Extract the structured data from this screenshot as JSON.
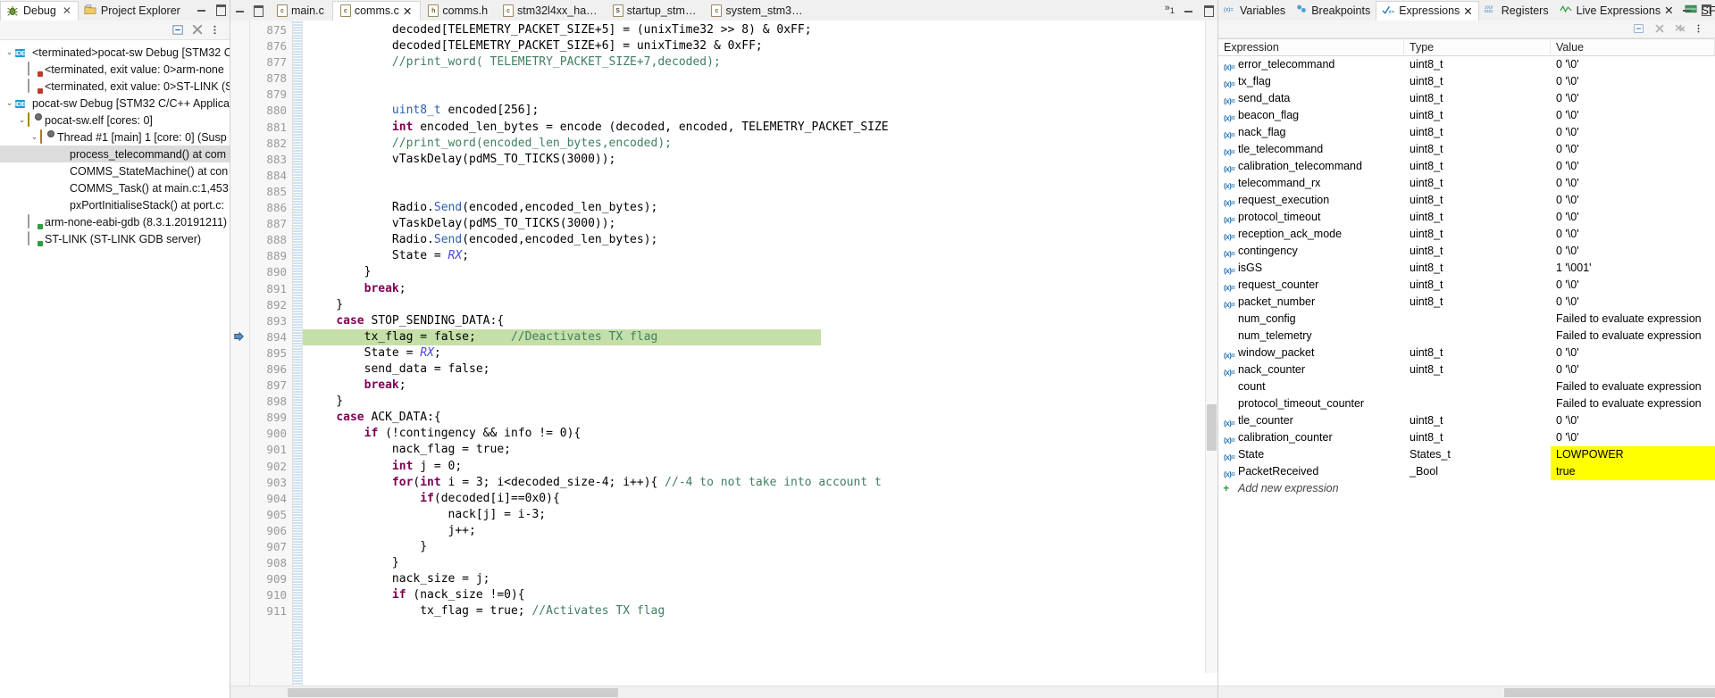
{
  "left_panel": {
    "tabs": [
      {
        "label": "Debug",
        "icon": "bug-icon",
        "active": true,
        "closable": true
      },
      {
        "label": "Project Explorer",
        "icon": "project-folder-icon",
        "active": false,
        "closable": false
      }
    ],
    "toolbar": [
      {
        "name": "collapse-all-icon",
        "label": "⊖"
      },
      {
        "name": "remove-all-terminated-icon",
        "label": "✖"
      },
      {
        "name": "view-menu-icon",
        "label": "⋮"
      }
    ],
    "window_controls": {
      "minimize": "minimize-icon",
      "maximize": "maximize-icon"
    },
    "tree": [
      {
        "indent": 0,
        "twist": "⌄",
        "icon": "ide-launch-icon",
        "label": "<terminated>pocat-sw Debug [STM32 C",
        "selected": false
      },
      {
        "indent": 1,
        "twist": "",
        "icon": "process-terminated-icon",
        "label": "<terminated, exit value: 0>arm-none",
        "selected": false
      },
      {
        "indent": 1,
        "twist": "",
        "icon": "process-terminated-icon",
        "label": "<terminated, exit value: 0>ST-LINK (S",
        "selected": false
      },
      {
        "indent": 0,
        "twist": "⌄",
        "icon": "ide-launch-icon",
        "label": "pocat-sw Debug [STM32 C/C++ Applica",
        "selected": false
      },
      {
        "indent": 1,
        "twist": "⌄",
        "icon": "program-icon",
        "label": "pocat-sw.elf [cores: 0]",
        "selected": false
      },
      {
        "indent": 2,
        "twist": "⌄",
        "icon": "thread-icon",
        "label": "Thread #1 [main] 1 [core: 0] (Susp",
        "selected": false
      },
      {
        "indent": 3,
        "twist": "",
        "icon": "stack-frame-icon",
        "label": "process_telecommand() at com",
        "selected": true
      },
      {
        "indent": 3,
        "twist": "",
        "icon": "stack-frame-icon",
        "label": "COMMS_StateMachine() at con",
        "selected": false
      },
      {
        "indent": 3,
        "twist": "",
        "icon": "stack-frame-icon",
        "label": "COMMS_Task() at main.c:1,453",
        "selected": false
      },
      {
        "indent": 3,
        "twist": "",
        "icon": "stack-frame-icon",
        "label": "pxPortInitialiseStack() at port.c:",
        "selected": false
      },
      {
        "indent": 1,
        "twist": "",
        "icon": "process-running-icon",
        "label": "arm-none-eabi-gdb (8.3.1.20191211)",
        "selected": false
      },
      {
        "indent": 1,
        "twist": "",
        "icon": "process-running-icon",
        "label": "ST-LINK (ST-LINK GDB server)",
        "selected": false
      }
    ]
  },
  "editor": {
    "tabs": [
      {
        "label": "main.c",
        "kind": "c",
        "active": false,
        "closable": false
      },
      {
        "label": "comms.c",
        "kind": "c",
        "active": true,
        "closable": true
      },
      {
        "label": "comms.h",
        "kind": "h",
        "active": false,
        "closable": false
      },
      {
        "label": "stm32l4xx_ha…",
        "kind": "c",
        "active": false,
        "closable": false
      },
      {
        "label": "startup_stm…",
        "kind": "s",
        "active": false,
        "closable": false
      },
      {
        "label": "system_stm3…",
        "kind": "c",
        "active": false,
        "closable": false
      }
    ],
    "overflow_indicator": "»",
    "overflow_count": "1",
    "window_controls": {
      "minimize": "minimize-icon",
      "maximize": "maximize-icon"
    },
    "first_line_number": 875,
    "exec_line": 894,
    "lines": [
      {
        "n": 875,
        "text": "decoded[TELEMETRY_PACKET_SIZE+5] = (unixTime32 >> 8) & 0xFF;"
      },
      {
        "n": 876,
        "text": "decoded[TELEMETRY_PACKET_SIZE+6] = unixTime32 & 0xFF;"
      },
      {
        "n": 877,
        "text": "//print_word( TELEMETRY_PACKET_SIZE+7,decoded);"
      },
      {
        "n": 878,
        "text": ""
      },
      {
        "n": 879,
        "text": ""
      },
      {
        "n": 880,
        "text": "uint8_t encoded[256];"
      },
      {
        "n": 881,
        "text": "int encoded_len_bytes = encode (decoded, encoded, TELEMETRY_PACKET_SIZE"
      },
      {
        "n": 882,
        "text": "//print_word(encoded_len_bytes,encoded);"
      },
      {
        "n": 883,
        "text": "vTaskDelay(pdMS_TO_TICKS(3000));"
      },
      {
        "n": 884,
        "text": ""
      },
      {
        "n": 885,
        "text": ""
      },
      {
        "n": 886,
        "text": "Radio.Send(encoded,encoded_len_bytes);"
      },
      {
        "n": 887,
        "text": "vTaskDelay(pdMS_TO_TICKS(3000));"
      },
      {
        "n": 888,
        "text": "Radio.Send(encoded,encoded_len_bytes);"
      },
      {
        "n": 889,
        "text": "State = RX;"
      },
      {
        "n": 890,
        "text": "}"
      },
      {
        "n": 891,
        "text": "break;"
      },
      {
        "n": 892,
        "text": "}"
      },
      {
        "n": 893,
        "text": "case STOP_SENDING_DATA:{"
      },
      {
        "n": 894,
        "text": "tx_flag = false;     //Deactivates TX flag"
      },
      {
        "n": 895,
        "text": "State = RX;"
      },
      {
        "n": 896,
        "text": "send_data = false;"
      },
      {
        "n": 897,
        "text": "break;"
      },
      {
        "n": 898,
        "text": "}"
      },
      {
        "n": 899,
        "text": "case ACK_DATA:{"
      },
      {
        "n": 900,
        "text": "if (!contingency && info != 0){"
      },
      {
        "n": 901,
        "text": "nack_flag = true;"
      },
      {
        "n": 902,
        "text": "int j = 0;"
      },
      {
        "n": 903,
        "text": "for(int i = 3; i<decoded_size-4; i++){ //-4 to not take into account t"
      },
      {
        "n": 904,
        "text": "if(decoded[i]==0x0){"
      },
      {
        "n": 905,
        "text": "nack[j] = i-3;"
      },
      {
        "n": 906,
        "text": "j++;"
      },
      {
        "n": 907,
        "text": "}"
      },
      {
        "n": 908,
        "text": "}"
      },
      {
        "n": 909,
        "text": "nack_size = j;"
      },
      {
        "n": 910,
        "text": "if (nack_size !=0){"
      },
      {
        "n": 911,
        "text": "tx_flag = true; //Activates TX flag"
      }
    ]
  },
  "right_panel": {
    "tabs": [
      {
        "label": "Variables",
        "icon": "variables-icon",
        "glyph": "(x)=",
        "active": false,
        "closable": false
      },
      {
        "label": "Breakpoints",
        "icon": "breakpoints-icon",
        "glyph": "●●",
        "active": false,
        "closable": false
      },
      {
        "label": "Expressions",
        "icon": "expressions-icon",
        "glyph": "√x",
        "active": true,
        "closable": true
      },
      {
        "label": "Registers",
        "icon": "registers-icon",
        "glyph": "1010",
        "active": false,
        "closable": false
      },
      {
        "label": "Live Expressions",
        "icon": "live-expressions-icon",
        "glyph": "∿",
        "active": false,
        "closable": true
      },
      {
        "label": "SFRs",
        "icon": "sfrs-icon",
        "glyph": "≣",
        "active": false,
        "closable": false
      }
    ],
    "toolbar": [
      {
        "name": "collapse-all-icon",
        "label": "⊖"
      },
      {
        "name": "remove-expression-icon",
        "label": "✖"
      },
      {
        "name": "remove-all-expressions-icon",
        "label": "✖"
      },
      {
        "name": "view-menu-icon",
        "label": "⋮"
      }
    ],
    "columns": [
      "Expression",
      "Type",
      "Value"
    ],
    "rows": [
      {
        "expression": "error_telecommand",
        "type": "uint8_t",
        "value": "0 '\\0'",
        "highlight": false
      },
      {
        "expression": "tx_flag",
        "type": "uint8_t",
        "value": "0 '\\0'",
        "highlight": false
      },
      {
        "expression": "send_data",
        "type": "uint8_t",
        "value": "0 '\\0'",
        "highlight": false
      },
      {
        "expression": "beacon_flag",
        "type": "uint8_t",
        "value": "0 '\\0'",
        "highlight": false
      },
      {
        "expression": "nack_flag",
        "type": "uint8_t",
        "value": "0 '\\0'",
        "highlight": false
      },
      {
        "expression": "tle_telecommand",
        "type": "uint8_t",
        "value": "0 '\\0'",
        "highlight": false
      },
      {
        "expression": "calibration_telecommand",
        "type": "uint8_t",
        "value": "0 '\\0'",
        "highlight": false
      },
      {
        "expression": "telecommand_rx",
        "type": "uint8_t",
        "value": "0 '\\0'",
        "highlight": false
      },
      {
        "expression": "request_execution",
        "type": "uint8_t",
        "value": "0 '\\0'",
        "highlight": false
      },
      {
        "expression": "protocol_timeout",
        "type": "uint8_t",
        "value": "0 '\\0'",
        "highlight": false
      },
      {
        "expression": "reception_ack_mode",
        "type": "uint8_t",
        "value": "0 '\\0'",
        "highlight": false
      },
      {
        "expression": "contingency",
        "type": "uint8_t",
        "value": "0 '\\0'",
        "highlight": false
      },
      {
        "expression": "isGS",
        "type": "uint8_t",
        "value": "1 '\\001'",
        "highlight": false
      },
      {
        "expression": "request_counter",
        "type": "uint8_t",
        "value": "0 '\\0'",
        "highlight": false
      },
      {
        "expression": "packet_number",
        "type": "uint8_t",
        "value": "0 '\\0'",
        "highlight": false
      },
      {
        "expression": "num_config",
        "type": "",
        "value": "Failed to evaluate expression",
        "highlight": false,
        "no_icon": true
      },
      {
        "expression": "num_telemetry",
        "type": "",
        "value": "Failed to evaluate expression",
        "highlight": false,
        "no_icon": true
      },
      {
        "expression": "window_packet",
        "type": "uint8_t",
        "value": "0 '\\0'",
        "highlight": false
      },
      {
        "expression": "nack_counter",
        "type": "uint8_t",
        "value": "0 '\\0'",
        "highlight": false
      },
      {
        "expression": "count",
        "type": "",
        "value": "Failed to evaluate expression",
        "highlight": false,
        "no_icon": true
      },
      {
        "expression": "protocol_timeout_counter",
        "type": "",
        "value": "Failed to evaluate expression",
        "highlight": false,
        "no_icon": true
      },
      {
        "expression": "tle_counter",
        "type": "uint8_t",
        "value": "0 '\\0'",
        "highlight": false
      },
      {
        "expression": "calibration_counter",
        "type": "uint8_t",
        "value": "0 '\\0'",
        "highlight": false
      },
      {
        "expression": "State",
        "type": "States_t",
        "value": "LOWPOWER",
        "highlight": true
      },
      {
        "expression": "PacketReceived",
        "type": "_Bool",
        "value": "true",
        "highlight": true
      }
    ],
    "add_new_expression": "Add new expression"
  },
  "colors": {
    "exec_line_highlight": "#c5dfa8",
    "changed_value_highlight": "#ffff00",
    "selection": "#dcdcdc",
    "accent_blue": "#1a6fb5",
    "keyword": "#7f0055",
    "comment": "#3f7f5f",
    "type_blue": "#2b5fad"
  }
}
